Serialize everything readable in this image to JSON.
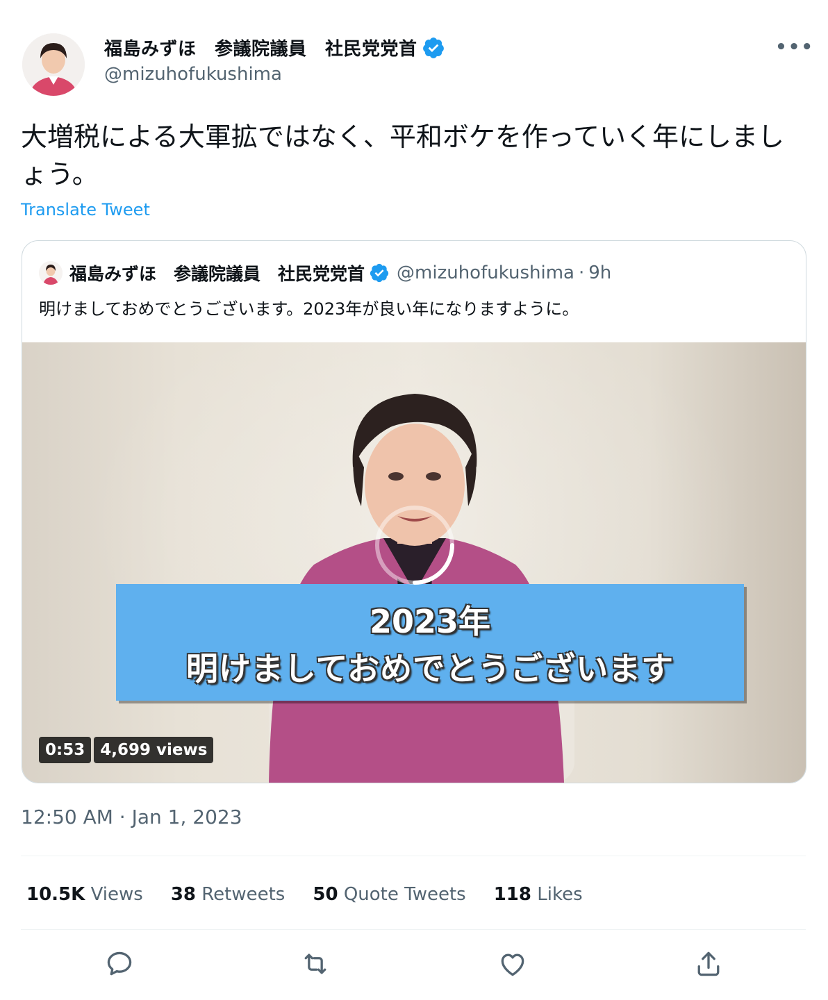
{
  "author": {
    "name": "福島みずほ　参議院議員　社民党党首",
    "handle": "@mizuhofukushima"
  },
  "tweet": {
    "text": "大増税による大軍拡ではなく、平和ボケを作っていく年にしましょう。",
    "translate_label": "Translate Tweet"
  },
  "quoted": {
    "name": "福島みずほ　参議院議員　社民党党首",
    "handle": "@mizuhofukushima",
    "separator": "·",
    "time": "9h",
    "text": "明けましておめでとうございます。2023年が良い年になりますように。",
    "video": {
      "caption_line1": "2023年",
      "caption_line2": "明けましておめでとうございます",
      "duration": "0:53",
      "views": "4,699 views"
    }
  },
  "timestamp": "12:50 AM · Jan 1, 2023",
  "stats": {
    "views_count": "10.5K",
    "views_label": "Views",
    "retweets_count": "38",
    "retweets_label": "Retweets",
    "quotes_count": "50",
    "quotes_label": "Quote Tweets",
    "likes_count": "118",
    "likes_label": "Likes"
  },
  "colors": {
    "accent": "#1d9bf0",
    "caption_bg": "#5fb0ee",
    "blazer": "#b44f87"
  },
  "icons": [
    "verified-badge-icon",
    "more-icon",
    "reply-icon",
    "retweet-icon",
    "like-icon",
    "share-icon",
    "loading-spinner-icon"
  ]
}
